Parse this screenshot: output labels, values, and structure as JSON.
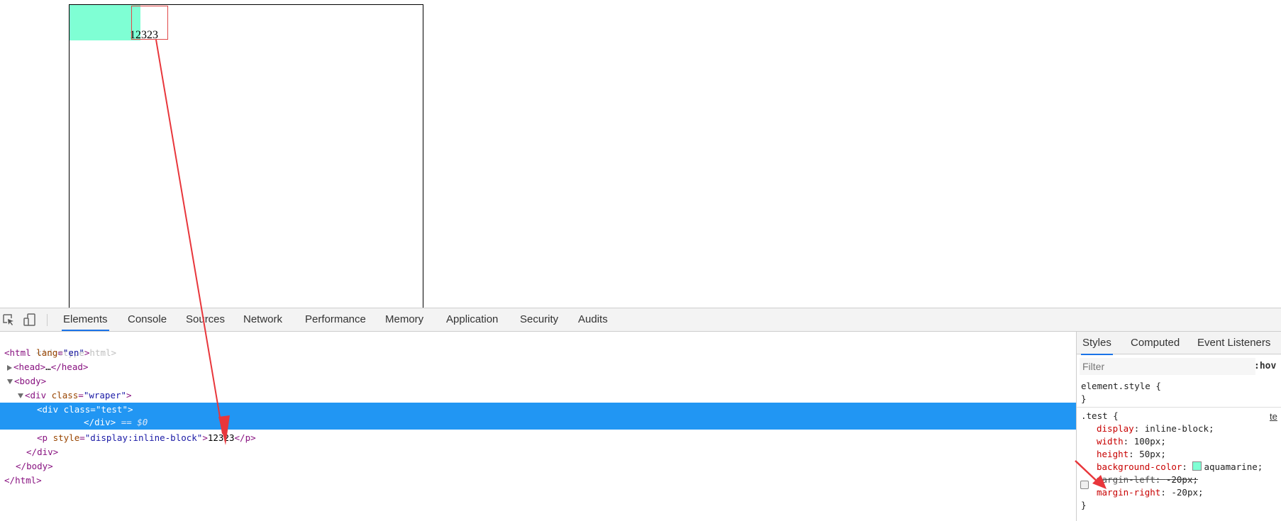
{
  "page": {
    "p_text": "12323"
  },
  "devtools": {
    "toolbar": {
      "inspect_icon": "inspect-element-icon",
      "device_icon": "device-toolbar-icon",
      "tabs": [
        "Elements",
        "Console",
        "Sources",
        "Network",
        "Performance",
        "Memory",
        "Application",
        "Security",
        "Audits"
      ],
      "active_tab": "Elements"
    },
    "elements": {
      "doctype": "<!doctype html>",
      "html_tag": "html",
      "html_attr_name": "lang",
      "html_attr_val": "\"en\"",
      "head_collapsed": "head",
      "head_ellipsis": "…",
      "body_tag": "body",
      "div_tag": "div",
      "class_attr": "class",
      "wraper_val": "\"wraper\"",
      "test_val": "\"test\"",
      "eq0": "== $0",
      "p_tag": "p",
      "style_attr": "style",
      "p_style_val": "\"display:inline-block\"",
      "p_text": "12323"
    },
    "styles": {
      "tabs": [
        "Styles",
        "Computed",
        "Event Listeners"
      ],
      "active_tab": "Styles",
      "filter_placeholder": "Filter",
      "hov_label": ":hov",
      "element_style_selector": "element.style {",
      "close_brace": "}",
      "test_selector": ".test {",
      "source_link": "te",
      "declarations": [
        {
          "prop": "display",
          "value": "inline-block;"
        },
        {
          "prop": "width",
          "value": "100px;"
        },
        {
          "prop": "height",
          "value": "50px;"
        },
        {
          "prop": "background-color",
          "value": "aquamarine;"
        },
        {
          "prop": "margin-left",
          "value": "-20px;"
        },
        {
          "prop": "margin-right",
          "value": "-20px;"
        }
      ]
    }
  },
  "colors": {
    "aquamarine": "#7fffd4",
    "selection_blue": "#2196f3",
    "annotation_red": "#e8363b"
  }
}
